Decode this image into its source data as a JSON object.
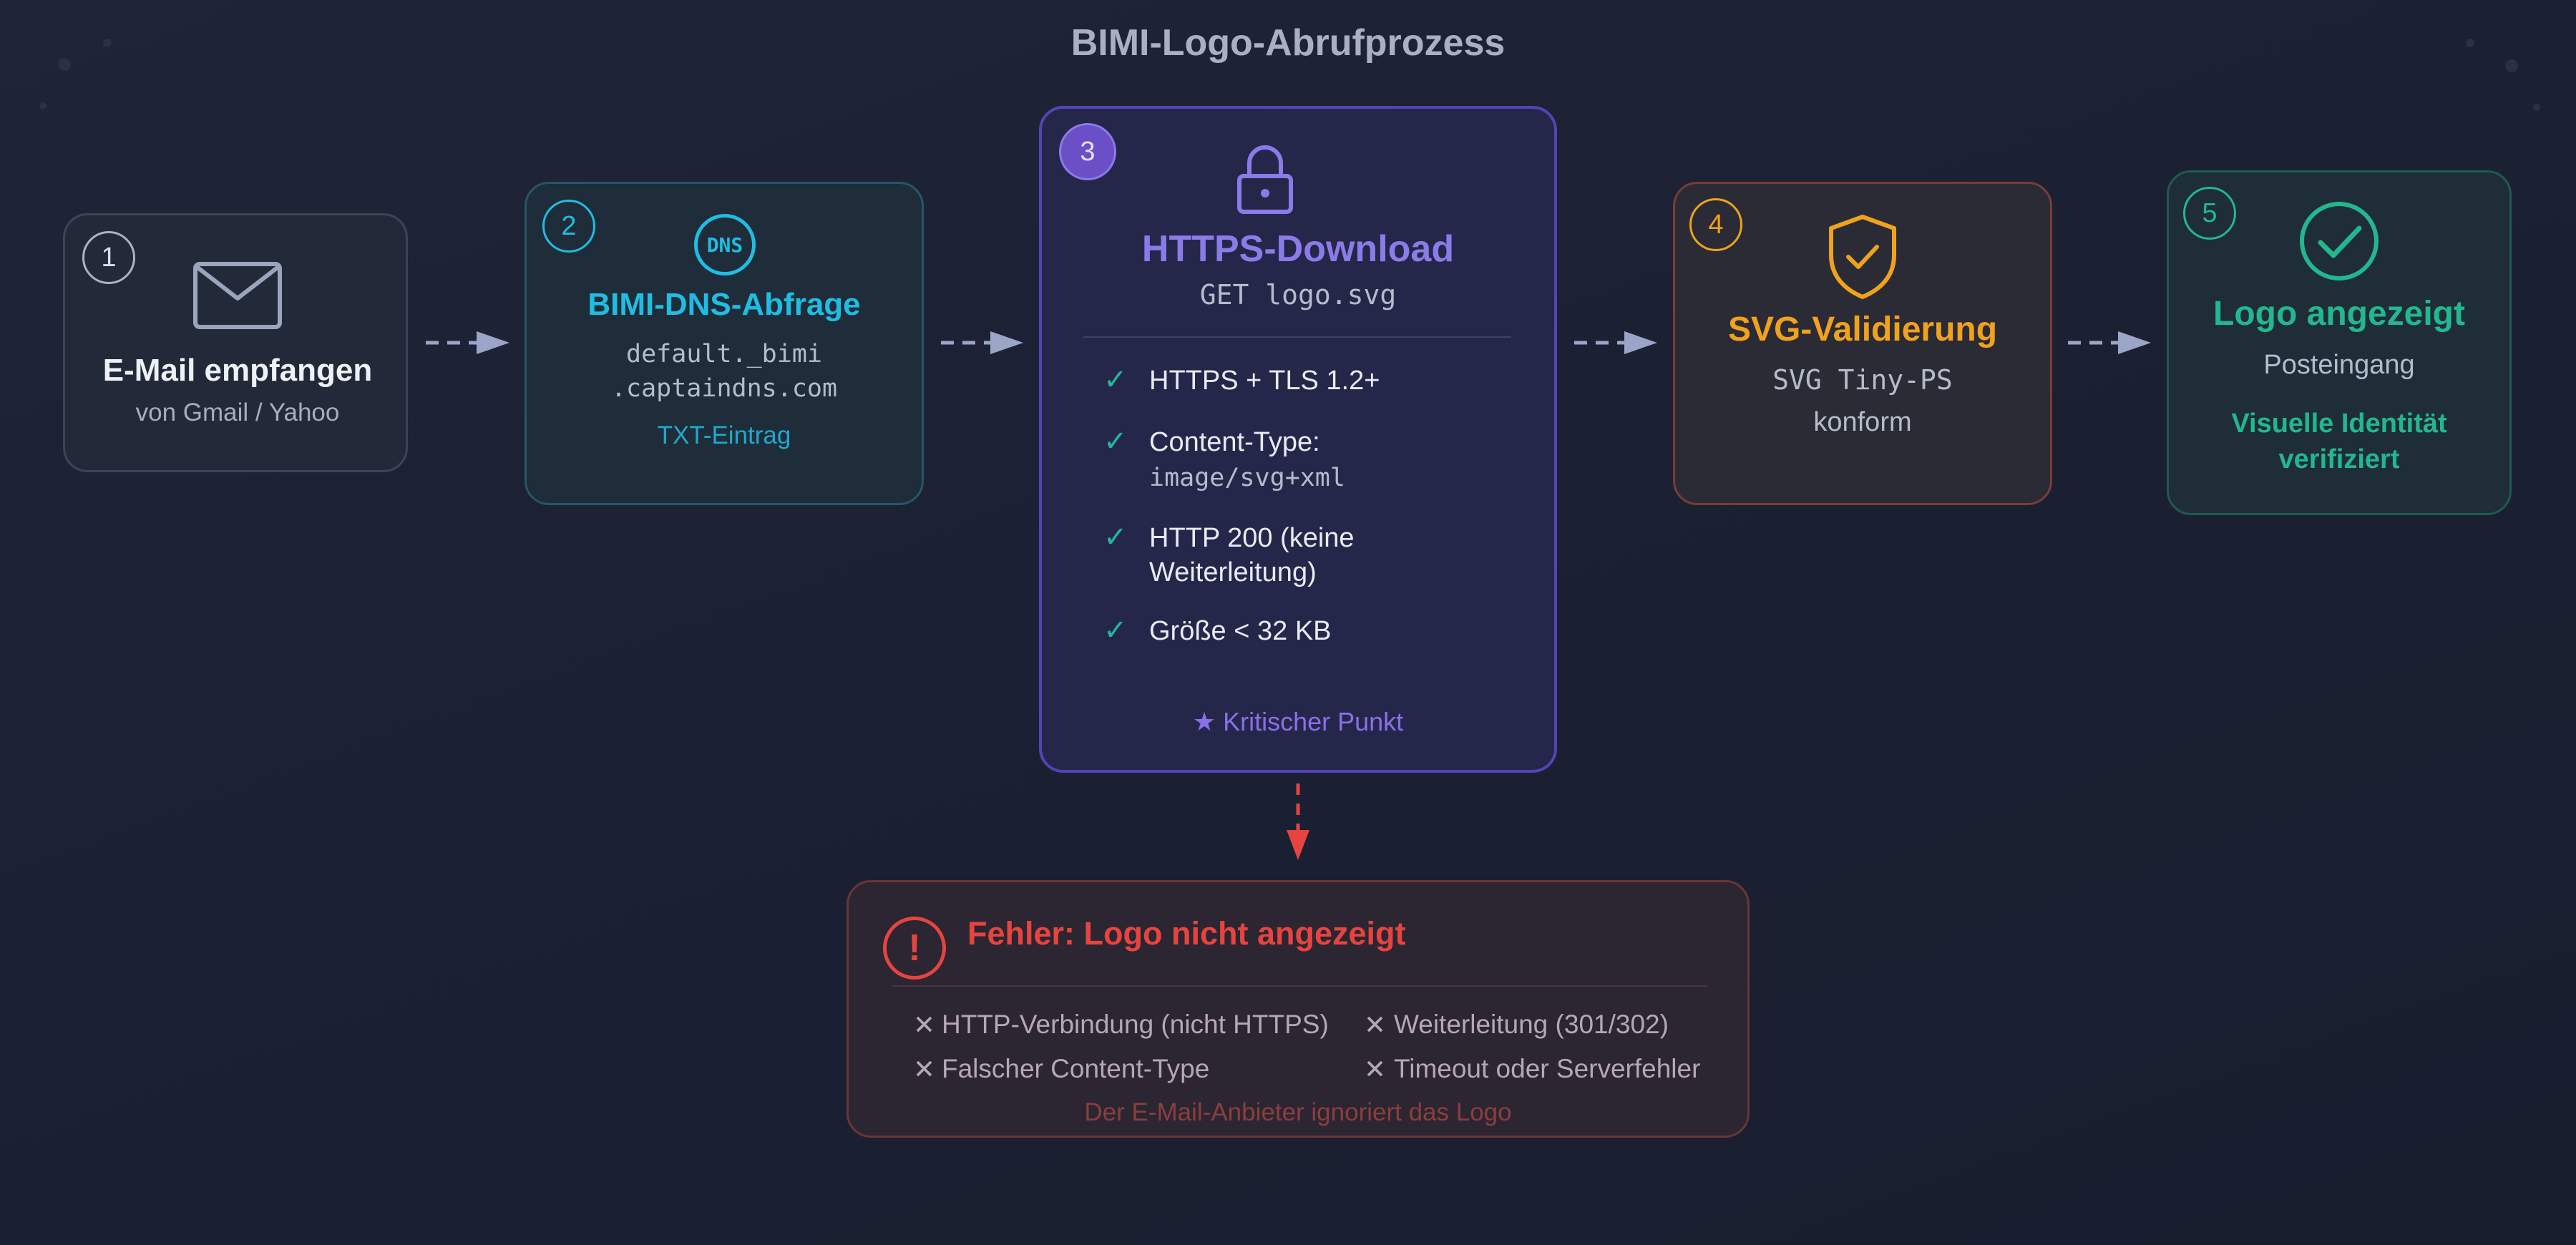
{
  "title": "BIMI-Logo-Abrufprozess",
  "colors": {
    "step1": "#a9b3c4",
    "step2": "#1fbde3",
    "step3": "#8b7be8",
    "step4": "#f0a21c",
    "step5": "#22b78e",
    "error": "#e6443f"
  },
  "steps": [
    {
      "number": "1",
      "icon": "envelope-icon",
      "title": "E-Mail empfangen",
      "subtitle": "von Gmail / Yahoo"
    },
    {
      "number": "2",
      "icon": "dns-icon",
      "icon_text": "DNS",
      "title": "BIMI-DNS-Abfrage",
      "line1": "default._bimi",
      "line2": ".captaindns.com",
      "note": "TXT-Eintrag"
    },
    {
      "number": "3",
      "icon": "lock-icon",
      "title": "HTTPS-Download",
      "subtitle": "GET logo.svg",
      "checks": [
        "HTTPS + TLS 1.2+",
        "Content-Type:",
        "HTTP 200 (keine",
        "Weiterleitung)",
        "Größe < 32 KB"
      ],
      "content_type_value": "image/svg+xml",
      "footer": "★ Kritischer Punkt"
    },
    {
      "number": "4",
      "icon": "shield-check-icon",
      "title": "SVG-Validierung",
      "line1": "SVG Tiny-PS",
      "line2": "konform"
    },
    {
      "number": "5",
      "icon": "check-circle-icon",
      "title": "Logo angezeigt",
      "subtitle": "Posteingang",
      "note1": "Visuelle Identität",
      "note2": "verifiziert"
    }
  ],
  "error": {
    "icon": "exclamation-icon",
    "title": "Fehler: Logo nicht angezeigt",
    "items": [
      "HTTP-Verbindung (nicht HTTPS)",
      "Weiterleitung (301/302)",
      "Falscher Content-Type",
      "Timeout oder Serverfehler"
    ],
    "footer": "Der E-Mail-Anbieter ignoriert das Logo"
  }
}
